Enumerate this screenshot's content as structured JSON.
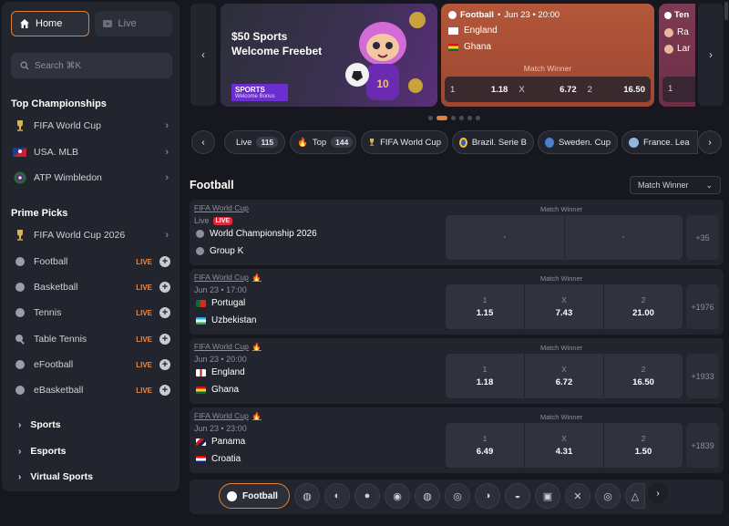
{
  "sidebar": {
    "tabs": [
      {
        "label": "Home",
        "icon": "home-icon",
        "active": true
      },
      {
        "label": "Live",
        "icon": "live-tv-icon",
        "active": false
      }
    ],
    "search_placeholder": "Search ⌘K",
    "top_championships_title": "Top Championships",
    "top_championships": [
      {
        "label": "FIFA World Cup",
        "icon": "fifa-trophy-icon"
      },
      {
        "label": "USA. MLB",
        "icon": "mlb-logo-icon"
      },
      {
        "label": "ATP Wimbledon",
        "icon": "wimbledon-logo-icon"
      }
    ],
    "prime_picks_title": "Prime Picks",
    "prime_picks": [
      {
        "label": "FIFA World Cup 2026",
        "icon": "fifa-trophy-icon",
        "live": false
      },
      {
        "label": "Football",
        "icon": "football-icon",
        "live": true
      },
      {
        "label": "Basketball",
        "icon": "basketball-icon",
        "live": true
      },
      {
        "label": "Tennis",
        "icon": "tennis-icon",
        "live": true
      },
      {
        "label": "Table Tennis",
        "icon": "table-tennis-icon",
        "live": true
      },
      {
        "label": "eFootball",
        "icon": "efootball-icon",
        "live": true
      },
      {
        "label": "eBasketball",
        "icon": "ebasketball-icon",
        "live": true
      }
    ],
    "live_tag": "LIVE",
    "groups": [
      "Sports",
      "Esports",
      "Virtual Sports"
    ]
  },
  "promo": {
    "line1": "$50 Sports",
    "line2": "Welcome Freebet",
    "badge_title": "SPORTS",
    "badge_sub": "Welcome Bonus"
  },
  "featured_match": {
    "sport": "Football",
    "separator": "•",
    "datetime": "Jun 23 • 20:00",
    "team1": "England",
    "team2": "Ghana",
    "market": "Match Winner",
    "odds": [
      {
        "label": "1",
        "value": "1.18"
      },
      {
        "label": "X",
        "value": "6.72"
      },
      {
        "label": "2",
        "value": "16.50"
      }
    ]
  },
  "featured_match_2": {
    "sport": "Ten",
    "team1": "Ra",
    "team2": "Lar",
    "odd_label": "1"
  },
  "chips": [
    {
      "label": "Live",
      "count": "115",
      "icon": "live-dot-icon"
    },
    {
      "label": "Top",
      "count": "144",
      "icon": "flame-icon"
    },
    {
      "label": "FIFA World Cup",
      "count": "",
      "icon": "fifa-trophy-icon"
    },
    {
      "label": "Brazil. Serie B",
      "count": "",
      "icon": "brazil-badge-icon"
    },
    {
      "label": "Sweden. Cup",
      "count": "",
      "icon": "globe-icon"
    },
    {
      "label": "France. Lea",
      "count": "",
      "icon": "ball-icon"
    }
  ],
  "section": {
    "title": "Football",
    "market_select": "Match Winner"
  },
  "matches": [
    {
      "league": "FIFA World Cup",
      "hot": false,
      "market": "Match Winner",
      "status": "Live",
      "live_badge": "LIVE",
      "team1": "World Championship 2026",
      "team2": "Group K",
      "odds": [
        {
          "label": "",
          "value": "-"
        },
        {
          "label": "",
          "value": "-"
        }
      ],
      "more": "+35"
    },
    {
      "league": "FIFA World Cup",
      "hot": true,
      "market": "Match Winner",
      "status": "Jun 23 • 17:00",
      "live_badge": "",
      "team1": "Portugal",
      "team2": "Uzbekistan",
      "odds": [
        {
          "label": "1",
          "value": "1.15"
        },
        {
          "label": "X",
          "value": "7.43"
        },
        {
          "label": "2",
          "value": "21.00"
        }
      ],
      "more": "+1976"
    },
    {
      "league": "FIFA World Cup",
      "hot": true,
      "market": "Match Winner",
      "status": "Jun 23 • 20:00",
      "live_badge": "",
      "team1": "England",
      "team2": "Ghana",
      "odds": [
        {
          "label": "1",
          "value": "1.18"
        },
        {
          "label": "X",
          "value": "6.72"
        },
        {
          "label": "2",
          "value": "16.50"
        }
      ],
      "more": "+1933"
    },
    {
      "league": "FIFA World Cup",
      "hot": true,
      "market": "Match Winner",
      "status": "Jun 23 • 23:00",
      "live_badge": "",
      "team1": "Panama",
      "team2": "Croatia",
      "odds": [
        {
          "label": "1",
          "value": "6.49"
        },
        {
          "label": "X",
          "value": "4.31"
        },
        {
          "label": "2",
          "value": "1.50"
        }
      ],
      "more": "+1839"
    }
  ],
  "sportbar": {
    "active_label": "Football",
    "icons": [
      "basketball-icon",
      "tennis-icon",
      "table-tennis-icon",
      "efootball-icon",
      "ebasketball-icon",
      "volleyball-icon",
      "rugby-icon",
      "handball-icon",
      "ice-hockey-icon",
      "mma-icon",
      "darts-icon",
      "snooker-icon"
    ]
  },
  "colors": {
    "accent": "#e0823a",
    "live_red": "#e02a3c",
    "background": "#17181f",
    "panel": "#23252e"
  }
}
